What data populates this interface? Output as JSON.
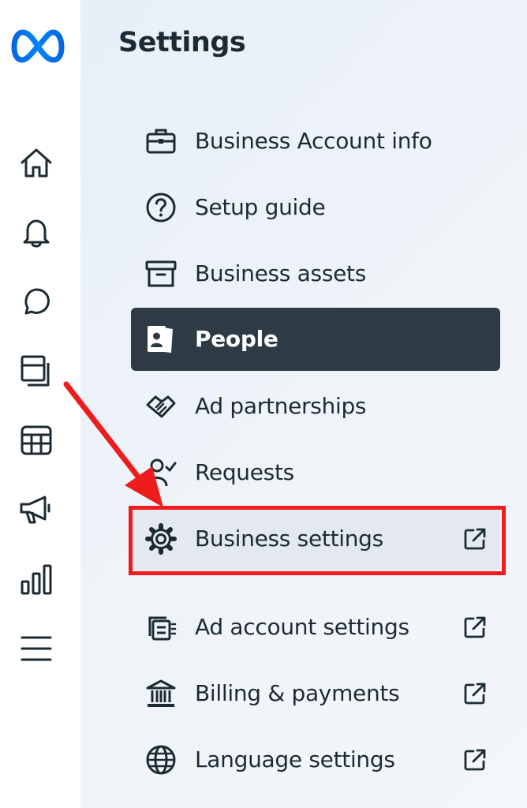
{
  "settings": {
    "title": "Settings",
    "items": [
      {
        "label": "Business Account info",
        "icon": "briefcase-icon"
      },
      {
        "label": "Setup guide",
        "icon": "question-circle-icon"
      },
      {
        "label": "Business assets",
        "icon": "archive-box-icon"
      },
      {
        "label": "People",
        "icon": "id-badge-icon",
        "selected": true
      },
      {
        "label": "Ad partnerships",
        "icon": "handshake-icon"
      },
      {
        "label": "Requests",
        "icon": "person-check-icon"
      },
      {
        "label": "Business settings",
        "icon": "gear-icon",
        "external": true,
        "highlighted": true
      },
      {
        "label": "Ad account settings",
        "icon": "ad-account-icon",
        "external": true
      },
      {
        "label": "Billing & payments",
        "icon": "bank-icon",
        "external": true
      },
      {
        "label": "Language settings",
        "icon": "globe-icon",
        "external": true
      }
    ]
  },
  "rail": {
    "icons": [
      "meta-logo-icon",
      "home-icon",
      "bell-icon",
      "chat-bubble-icon",
      "pages-icon",
      "calendar-grid-icon",
      "megaphone-icon",
      "bar-chart-icon",
      "menu-icon"
    ]
  },
  "colors": {
    "selected_bg": "#2e3b45",
    "text": "#1c2b33",
    "annotation_red": "#ee1c1c",
    "meta_blue": "#0668e1"
  }
}
